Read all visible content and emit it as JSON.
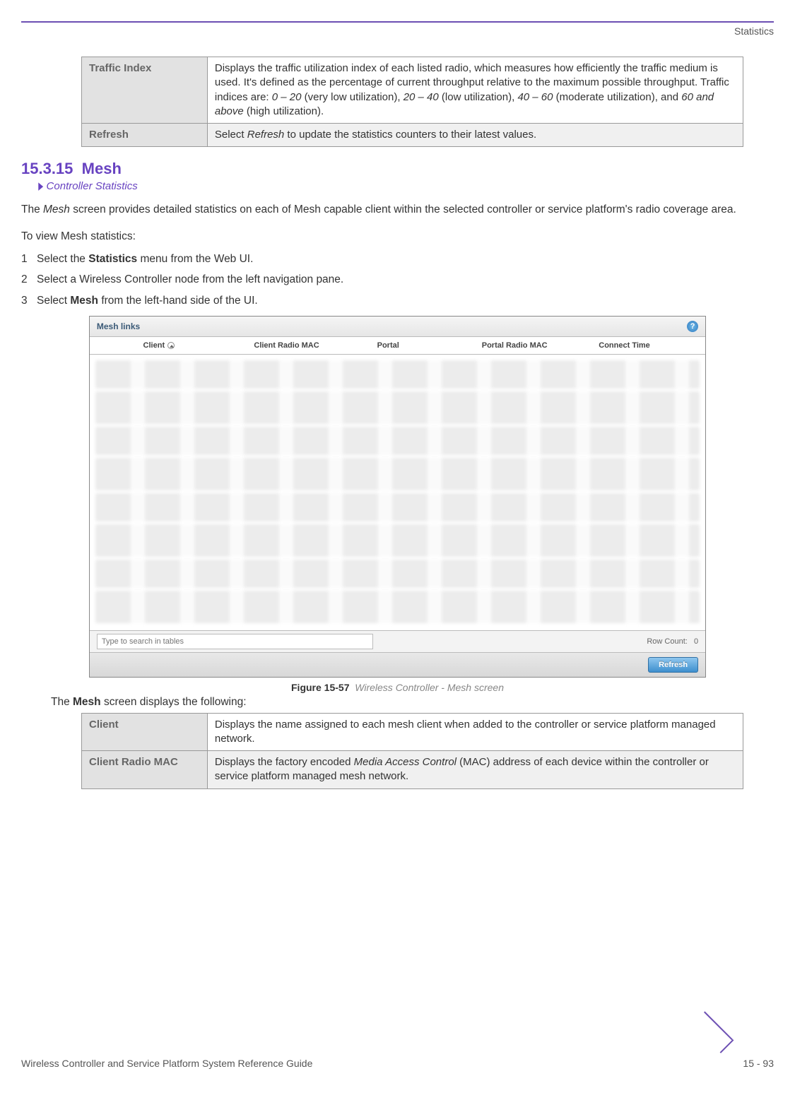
{
  "header": {
    "section": "Statistics"
  },
  "defs_top": [
    {
      "label": "Traffic Index",
      "desc_parts": [
        "Displays the traffic utilization index of each listed radio, which measures how efficiently the traffic medium is used. It's defined as the percentage of current throughput relative to the maximum possible throughput. Traffic indices are: ",
        {
          "i": "0 – 20"
        },
        " (very low utilization), ",
        {
          "i": "20 – 40"
        },
        " (low utilization), ",
        {
          "i": "40 – 60"
        },
        " (moderate utilization), and ",
        {
          "i": "60 and above"
        },
        " (high utilization)."
      ],
      "alt": false
    },
    {
      "label": "Refresh",
      "desc_parts": [
        "Select ",
        {
          "i": "Refresh"
        },
        " to update the statistics counters to their latest values."
      ],
      "alt": true
    }
  ],
  "section": {
    "number": "15.3.15",
    "title": "Mesh",
    "subref": "Controller Statistics",
    "intro_parts": [
      "The ",
      {
        "i": "Mesh"
      },
      " screen provides detailed statistics on each of Mesh capable client within the selected controller or service platform's radio coverage area."
    ],
    "lead": "To view Mesh statistics:",
    "steps": [
      {
        "n": "1",
        "parts": [
          "Select the ",
          {
            "b": "Statistics"
          },
          " menu from the Web UI."
        ]
      },
      {
        "n": "2",
        "parts": [
          "Select a Wireless Controller node from the left navigation pane."
        ]
      },
      {
        "n": "3",
        "parts": [
          "Select ",
          {
            "b": "Mesh"
          },
          " from the left-hand side of the UI."
        ]
      }
    ]
  },
  "figure": {
    "panel_title": "Mesh links",
    "columns": [
      "Client",
      "Client Radio MAC",
      "Portal",
      "Portal Radio MAC",
      "Connect Time"
    ],
    "search_placeholder": "Type to search in tables",
    "row_count_label": "Row Count:",
    "row_count_value": "0",
    "refresh_button": "Refresh",
    "caption_label": "Figure 15-57",
    "caption_text": "Wireless Controller - Mesh screen"
  },
  "below_figure_parts": [
    "The ",
    {
      "b": "Mesh"
    },
    " screen displays the following:"
  ],
  "defs_bottom": [
    {
      "label": "Client",
      "desc_parts": [
        "Displays the name assigned to each mesh client when added to the controller or service platform managed network."
      ],
      "alt": false
    },
    {
      "label": "Client Radio MAC",
      "desc_parts": [
        "Displays the factory encoded ",
        {
          "i": "Media Access Control"
        },
        " (MAC) address of each device within the controller or service platform managed mesh network."
      ],
      "alt": true
    }
  ],
  "footer": {
    "doc_title": "Wireless Controller and Service Platform System Reference Guide",
    "page": "15 - 93"
  }
}
